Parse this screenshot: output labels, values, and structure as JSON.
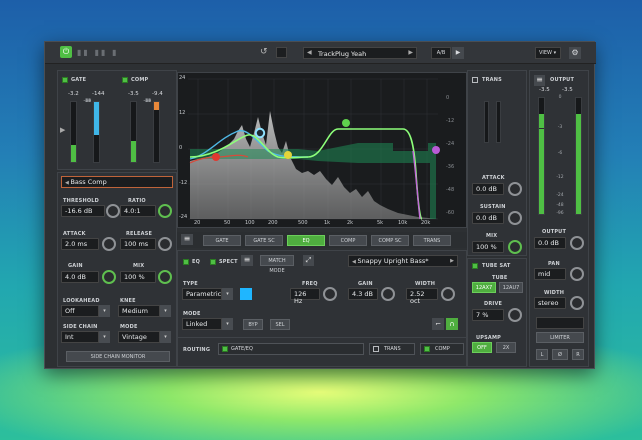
{
  "topbar": {
    "preset_name": "TrackPlug Yeah",
    "ab": "A/B",
    "view": "VIEW"
  },
  "gate": {
    "title": "GATE",
    "meter_vals": [
      "-3.2",
      "-144"
    ],
    "scale": [
      "0",
      "-6",
      "-12",
      "-24",
      "-36",
      "-48",
      "-60",
      "-72"
    ],
    "threshold_label": "THRESHOLD",
    "threshold": "-16.6 dB",
    "ratio_label": "RATIO",
    "ratio": "4.0:1",
    "attack_label": "ATTACK",
    "attack": "2.0 ms",
    "release_label": "RELEASE",
    "release": "100 ms",
    "gain_label": "GAIN",
    "gain": "4.0 dB",
    "mix_label": "MIX",
    "mix": "100 %",
    "lookahead_label": "LOOKAHEAD",
    "lookahead": "Off",
    "knee_label": "KNEE",
    "knee": "Medium",
    "sidechain_label": "SIDE CHAIN",
    "sidechain": "Int",
    "mode_label": "MODE",
    "mode": "Vintage",
    "sc_monitor": "SIDE CHAIN MONITOR"
  },
  "comp": {
    "title": "COMP",
    "meter_vals": [
      "-3.5",
      "-9.4"
    ],
    "scale": [
      "0",
      "-6",
      "-12",
      "-24",
      "-36",
      "-48",
      "-60",
      "-72"
    ],
    "preset": "Bass Comp"
  },
  "eq_graph": {
    "y_ticks_left": [
      "24",
      "12",
      "0",
      "-12",
      "-24"
    ],
    "y_ticks_right": [
      "0",
      "-12",
      "-24",
      "-36",
      "-48",
      "-60"
    ],
    "x_ticks": [
      "20",
      "50",
      "100",
      "200",
      "500",
      "1k",
      "2k",
      "5k",
      "10k",
      "20k"
    ]
  },
  "tabs": [
    "GATE",
    "GATE SC",
    "EQ",
    "COMP",
    "COMP SC",
    "TRANS"
  ],
  "eq": {
    "eq_label": "EQ",
    "spect_label": "SPECT",
    "match_mode": "MATCH MODE",
    "preset": "Snappy Upright Bass*",
    "type_label": "TYPE",
    "type": "Parametric",
    "freq_label": "FREQ",
    "freq": "126 Hz",
    "gain_label": "GAIN",
    "gain": "4.3 dB",
    "width_label": "WIDTH",
    "width": "2.52 oct",
    "mode_label": "MODE",
    "mode": "Linked",
    "byp": "BYP",
    "sel": "SEL",
    "routing_label": "ROUTING",
    "routing_items": [
      "GATE/EQ",
      "TRANS",
      "COMP"
    ]
  },
  "trans": {
    "title": "TRANS",
    "attack_label": "ATTACK",
    "attack": "0.0 dB",
    "sustain_label": "SUSTAIN",
    "sustain": "0.0 dB",
    "mix_label": "MIX",
    "mix": "100 %"
  },
  "tubesat": {
    "title": "TUBE SAT",
    "tube_label": "TUBE",
    "tube_a": "12AX7",
    "tube_b": "12AU7",
    "drive_label": "DRIVE",
    "drive": "7 %",
    "upsamp_label": "UPSAMP",
    "off": "OFF",
    "x2": "2X"
  },
  "output": {
    "title": "OUTPUT",
    "meter_vals": [
      "-3.5",
      "-3.5"
    ],
    "scale": [
      "0",
      "-3",
      "-6",
      "-12",
      "-24",
      "-48",
      "-96"
    ],
    "output_label": "OUTPUT",
    "output": "0.0 dB",
    "pan_label": "PAN",
    "pan": "mid",
    "width_label": "WIDTH",
    "width": "stereo",
    "limiter": "LIMITER",
    "l": "L",
    "phase": "Ø",
    "r": "R"
  }
}
